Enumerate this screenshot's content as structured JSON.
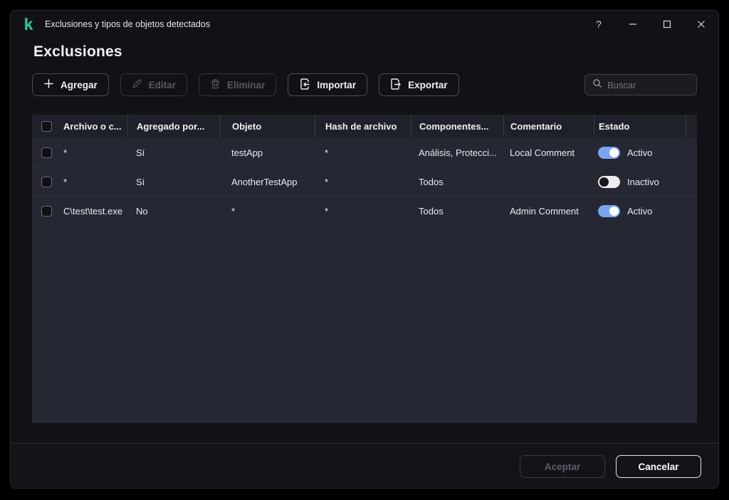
{
  "window": {
    "title": "Exclusiones y tipos de objetos detectados",
    "help_label": "?"
  },
  "page": {
    "heading": "Exclusiones"
  },
  "toolbar": {
    "add_label": "Agregar",
    "edit_label": "Editar",
    "delete_label": "Eliminar",
    "import_label": "Importar",
    "export_label": "Exportar",
    "search_placeholder": "Buscar"
  },
  "table": {
    "columns": {
      "file": "Archivo o c...",
      "added_by": "Agregado por...",
      "object": "Objeto",
      "hash": "Hash de archivo",
      "components": "Componentes...",
      "comment": "Comentario",
      "state": "Estado"
    },
    "rows": [
      {
        "file": "*",
        "added_by": "Sí",
        "object": "testApp",
        "hash": "*",
        "components": "Análisis, Protecci...",
        "comment": "Local Comment",
        "state": "Activo",
        "enabled": true
      },
      {
        "file": "*",
        "added_by": "Sí",
        "object": "AnotherTestApp",
        "hash": "*",
        "components": "Todos",
        "comment": "",
        "state": "Inactivo",
        "enabled": false
      },
      {
        "file": "C\\test\\test.exe",
        "added_by": "No",
        "object": "*",
        "hash": "*",
        "components": "Todos",
        "comment": "Admin Comment",
        "state": "Activo",
        "enabled": true
      }
    ]
  },
  "footer": {
    "accept_label": "Aceptar",
    "cancel_label": "Cancelar"
  },
  "colors": {
    "brand_teal": "#27c9a6",
    "toggle_on_blue": "#7ba4f0"
  }
}
